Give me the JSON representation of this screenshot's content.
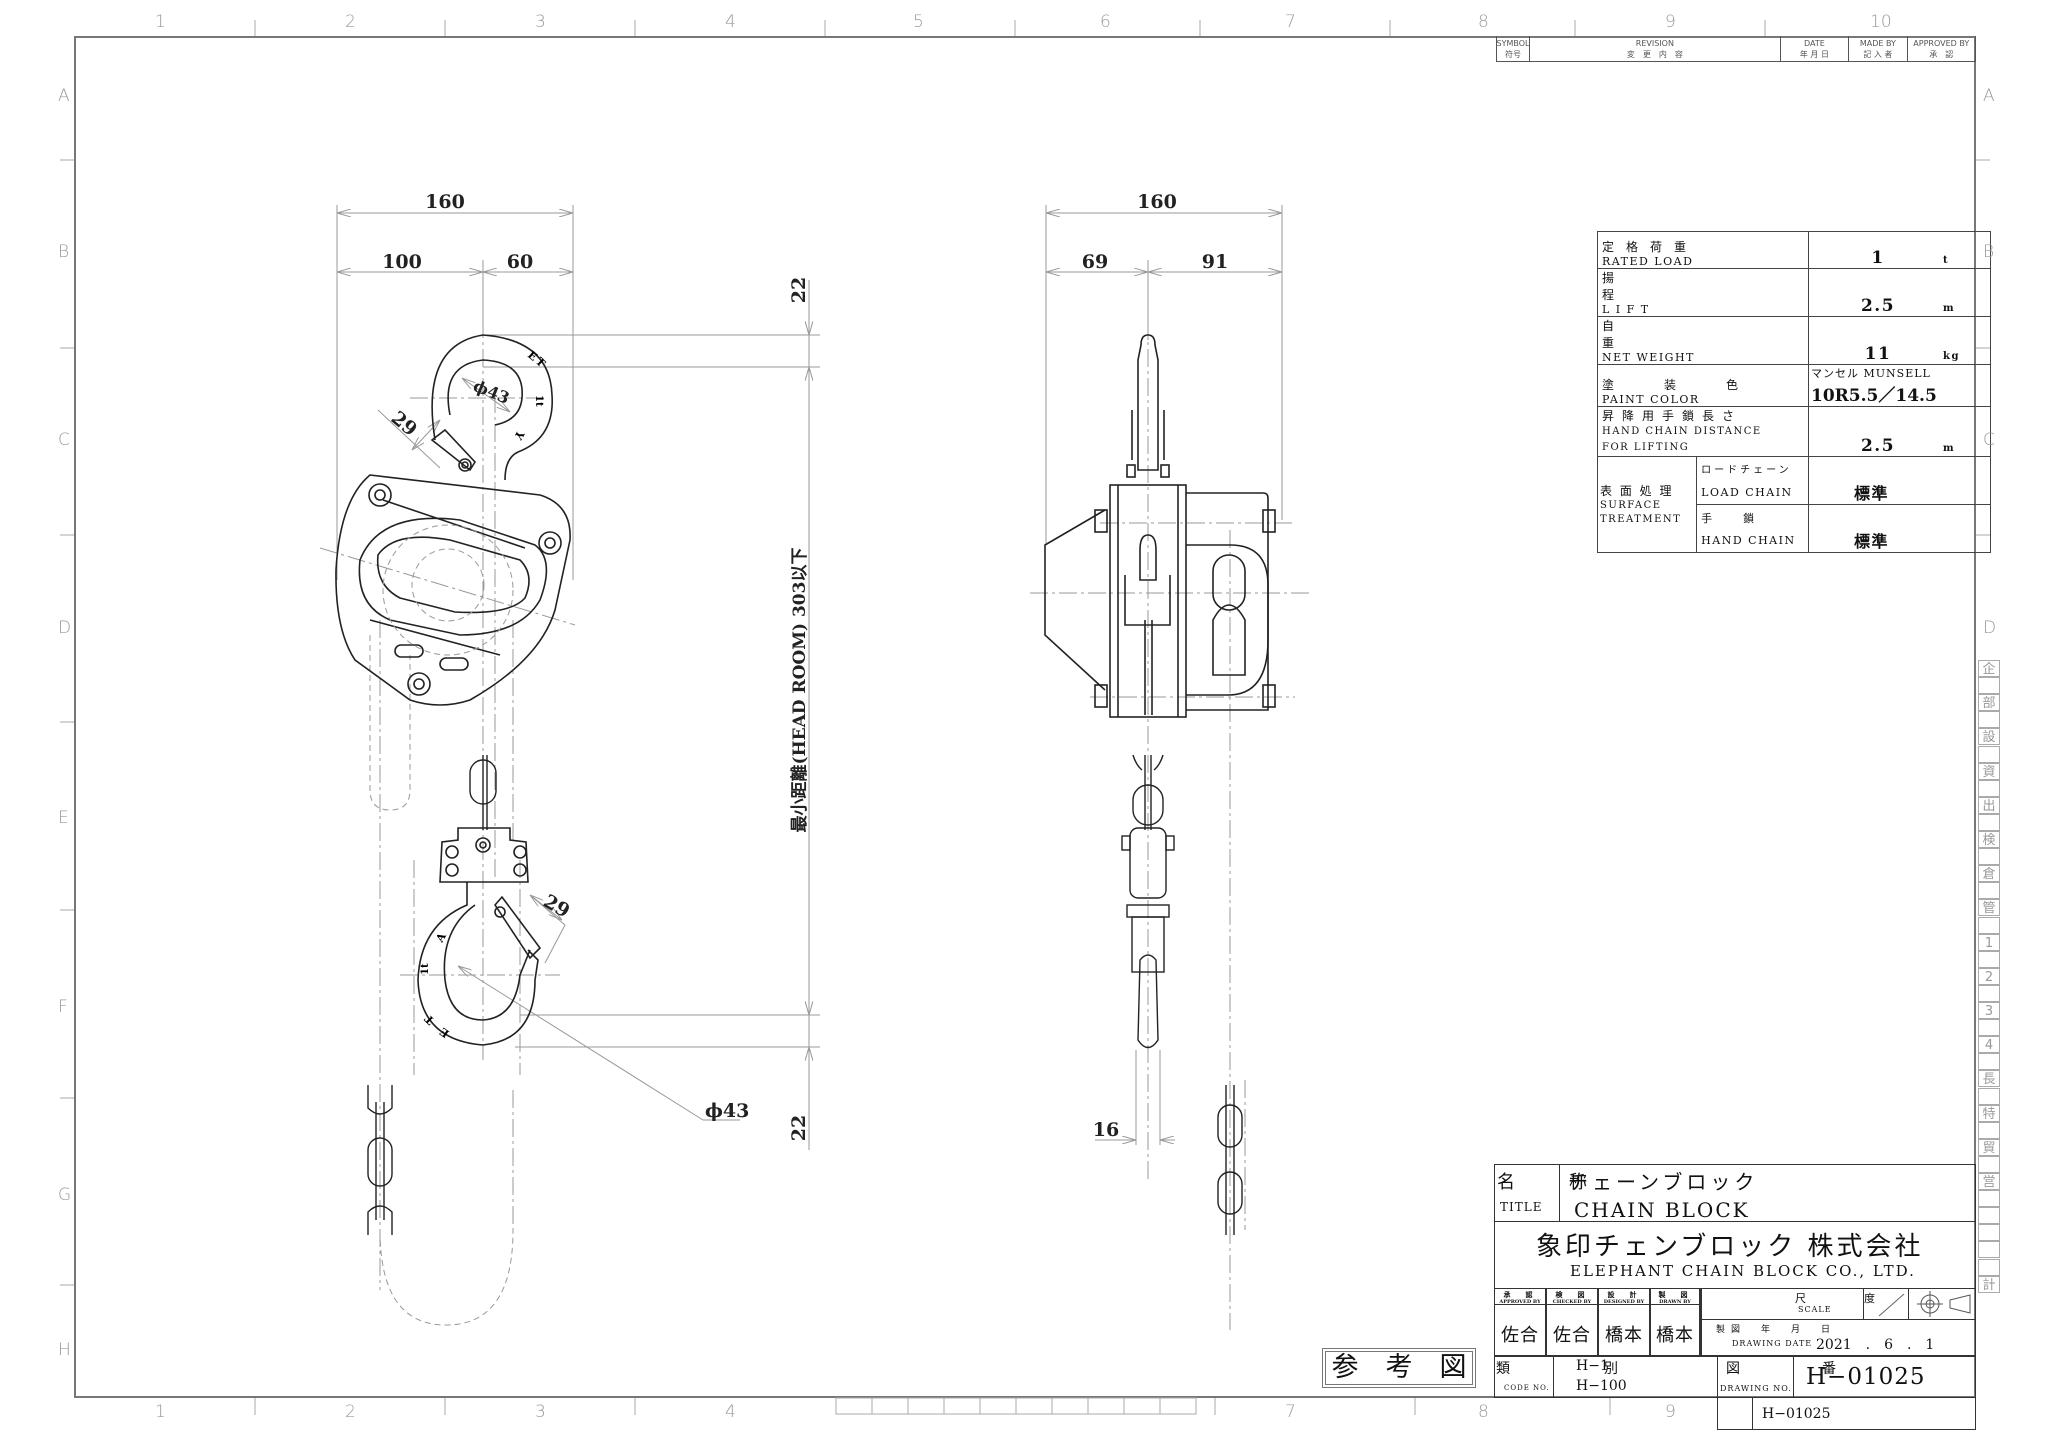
{
  "zones": {
    "columns": [
      "1",
      "2",
      "3",
      "4",
      "5",
      "6",
      "7",
      "8",
      "9",
      "10"
    ],
    "rows": [
      "A",
      "B",
      "C",
      "D",
      "E",
      "F",
      "G",
      "H"
    ]
  },
  "revision_block": {
    "headers": [
      {
        "en": "SYMBOL",
        "jp": "符号"
      },
      {
        "en": "REVISION",
        "jp": "変　更　内　容"
      },
      {
        "en": "DATE",
        "jp": "年 月 日"
      },
      {
        "en": "MADE BY",
        "jp": "記 入 者"
      },
      {
        "en": "APPROVED BY",
        "jp": "承　認"
      }
    ]
  },
  "front_view": {
    "dim_overall_width": "160",
    "dim_left": "100",
    "dim_right": "60",
    "dim_latch_top": "29",
    "dim_hook_top_dia": "ϕ43",
    "hook_top_marks": [
      "E",
      "T",
      "1t",
      "Y"
    ],
    "dim_latch_bottom": "29",
    "dim_hook_bottom_dia": "ϕ43",
    "hook_bottom_marks": [
      "A",
      "1t",
      "T",
      "E"
    ]
  },
  "headroom": {
    "top_dim": "22",
    "label": "最小距離(HEAD ROOM) 303以下",
    "bottom_dim": "22"
  },
  "side_view": {
    "dim_overall_width": "160",
    "dim_left": "69",
    "dim_right": "91",
    "dim_hook_width": "16"
  },
  "spec_table": {
    "rows": [
      {
        "jp": "定格荷重",
        "en": "RATED LOAD",
        "value": "1",
        "unit": "t"
      },
      {
        "jp": "揚程",
        "en": "L I F T",
        "value": "2.5",
        "unit": "m"
      },
      {
        "jp": "自重",
        "en": "NET WEIGHT",
        "value": "11",
        "unit": "kg"
      },
      {
        "jp": "塗装色",
        "en": "PAINT COLOR",
        "value_label": "マンセル MUNSELL",
        "value": "10R5.5／14.5",
        "unit": ""
      },
      {
        "jp": "昇降用手鎖長さ",
        "en": "HAND CHAIN DISTANCE",
        "en2": "FOR LIFTING",
        "value": "2.5",
        "unit": "m"
      }
    ],
    "surface_treatment": {
      "jp": "表 面 処 理",
      "en": "SURFACE TREATMENT",
      "items": [
        {
          "jp": "ロードチェーン",
          "en": "LOAD CHAIN",
          "value": "標準"
        },
        {
          "jp": "手　　鎖",
          "en": "HAND CHAIN",
          "value": "標準"
        }
      ]
    }
  },
  "reference_stamp": "参　考　図",
  "title_block": {
    "name_label_jp": "名　称",
    "name_label_en": "TITLE",
    "title_jp": "チェーンブロック",
    "title_en": "CHAIN BLOCK",
    "company_jp": "象印チェンブロック 株式会社",
    "company_en": "ELEPHANT CHAIN BLOCK CO., LTD.",
    "signoff": [
      {
        "jp": "承　認",
        "en": "APPROVED BY",
        "name": "佐合"
      },
      {
        "jp": "検　図",
        "en": "CHECKED BY",
        "name": "佐合"
      },
      {
        "jp": "設　計",
        "en": "DESIGNED BY",
        "name": "橋本"
      },
      {
        "jp": "製　図",
        "en": "DRAWN BY",
        "name": "橋本"
      }
    ],
    "scale_label_jp": "尺　　度",
    "scale_label_en": "SCALE",
    "date_label_jp": "製図　年　月　日",
    "date_label_en": "DRAWING DATE",
    "drawing_date": "2021　.　6　.　1",
    "code_label_jp": "類　　別",
    "code_label_en": "CODE NO.",
    "code_values": [
      "H−1",
      "H−100"
    ],
    "drawing_no_label_jp": "図　　番",
    "drawing_no_label_en": "DRAWING NO.",
    "drawing_no": "H−01025",
    "drawing_no_small": "H−01025"
  },
  "side_strip": [
    "企",
    "",
    "部",
    "",
    "設",
    "",
    "資",
    "",
    "出",
    "",
    "検",
    "",
    "倉",
    "",
    "管",
    "",
    "1",
    "",
    "2",
    "",
    "3",
    "",
    "4",
    "",
    "長",
    "",
    "特",
    "",
    "貿",
    "",
    "営",
    "",
    "",
    "",
    "",
    "",
    "計"
  ]
}
